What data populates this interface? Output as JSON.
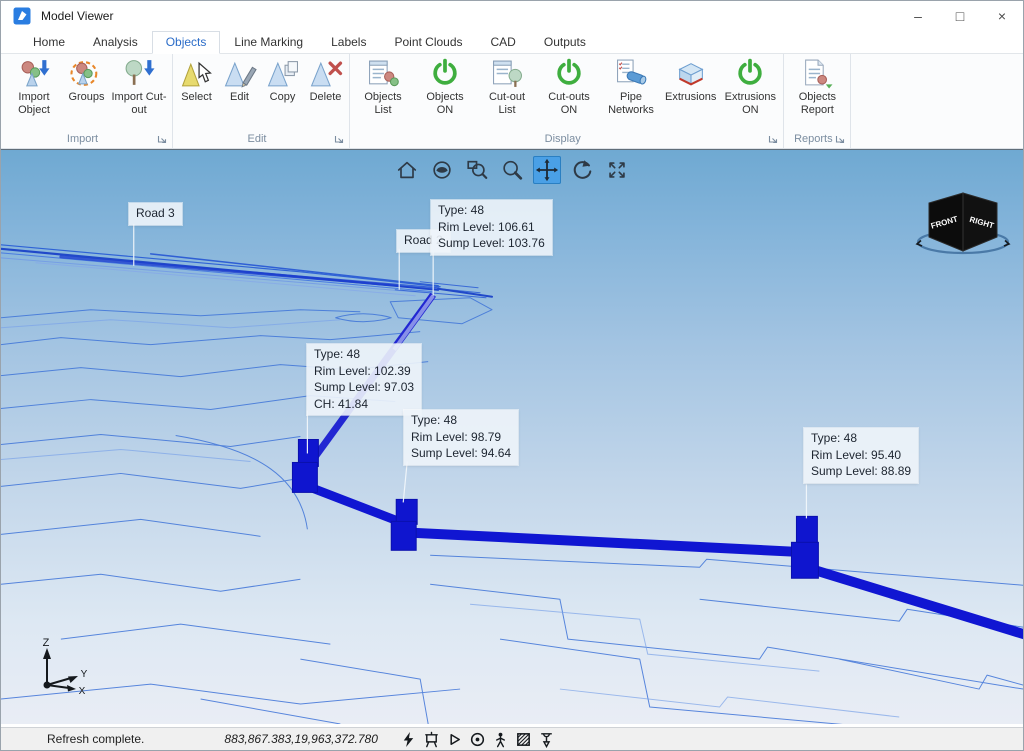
{
  "window": {
    "title": "Model Viewer",
    "controls": {
      "minimize": "–",
      "maximize": "□",
      "close": "×"
    }
  },
  "tabs": {
    "active": "Objects",
    "items": [
      {
        "label": "Home"
      },
      {
        "label": "Analysis"
      },
      {
        "label": "Objects"
      },
      {
        "label": "Line Marking"
      },
      {
        "label": "Labels"
      },
      {
        "label": "Point Clouds"
      },
      {
        "label": "CAD"
      },
      {
        "label": "Outputs"
      }
    ]
  },
  "ribbon": {
    "groups": [
      {
        "label": "Import",
        "buttons": [
          {
            "label": "Import Object"
          },
          {
            "label": "Groups"
          },
          {
            "label": "Import Cut-out"
          }
        ]
      },
      {
        "label": "Edit",
        "buttons": [
          {
            "label": "Select"
          },
          {
            "label": "Edit"
          },
          {
            "label": "Copy"
          },
          {
            "label": "Delete"
          }
        ]
      },
      {
        "label": "Display",
        "buttons": [
          {
            "label": "Objects List"
          },
          {
            "label": "Objects ON"
          },
          {
            "label": "Cut-out List"
          },
          {
            "label": "Cut-outs ON"
          },
          {
            "label": "Pipe Networks"
          },
          {
            "label": "Extrusions"
          },
          {
            "label": "Extrusions ON"
          }
        ]
      },
      {
        "label": "Reports",
        "buttons": [
          {
            "label": "Objects Report"
          }
        ]
      }
    ]
  },
  "viewport": {
    "toolbar": {
      "icons": [
        "home",
        "orbit",
        "zoom-window",
        "zoom",
        "pan",
        "rotate-view",
        "zoom-extents"
      ],
      "active": "pan"
    },
    "road_labels": [
      {
        "text": "Road 3"
      },
      {
        "text": "Road 2"
      }
    ],
    "annotations": [
      {
        "lines": [
          "Type: 48",
          "Rim Level: 106.61",
          "Sump Level: 103.76"
        ]
      },
      {
        "lines": [
          "Type: 48",
          "Rim Level: 102.39",
          "Sump Level: 97.03",
          "CH: 41.84"
        ]
      },
      {
        "lines": [
          "Type: 48",
          "Rim Level: 98.79",
          "Sump Level: 94.64"
        ]
      },
      {
        "lines": [
          "Type: 48",
          "Rim Level: 95.40",
          "Sump Level: 88.89"
        ]
      }
    ],
    "view_cube": {
      "left_face": "FRONT",
      "right_face": "RIGHT"
    },
    "axis": {
      "z": "Z",
      "y": "Y",
      "x": "X"
    },
    "colors": {
      "pipe": "#1016d2",
      "contour": "#3f74d8",
      "background_top": "#6fa9d2",
      "background_bottom": "#e9edf5",
      "toolbar_active": "#4aa0e6"
    }
  },
  "status_bar": {
    "message": "Refresh complete.",
    "coordinates": "883,867.383,19,963,372.780",
    "icons": [
      "flash",
      "projector-screen",
      "play",
      "eye",
      "walking-person",
      "hatch",
      "plumb"
    ]
  }
}
